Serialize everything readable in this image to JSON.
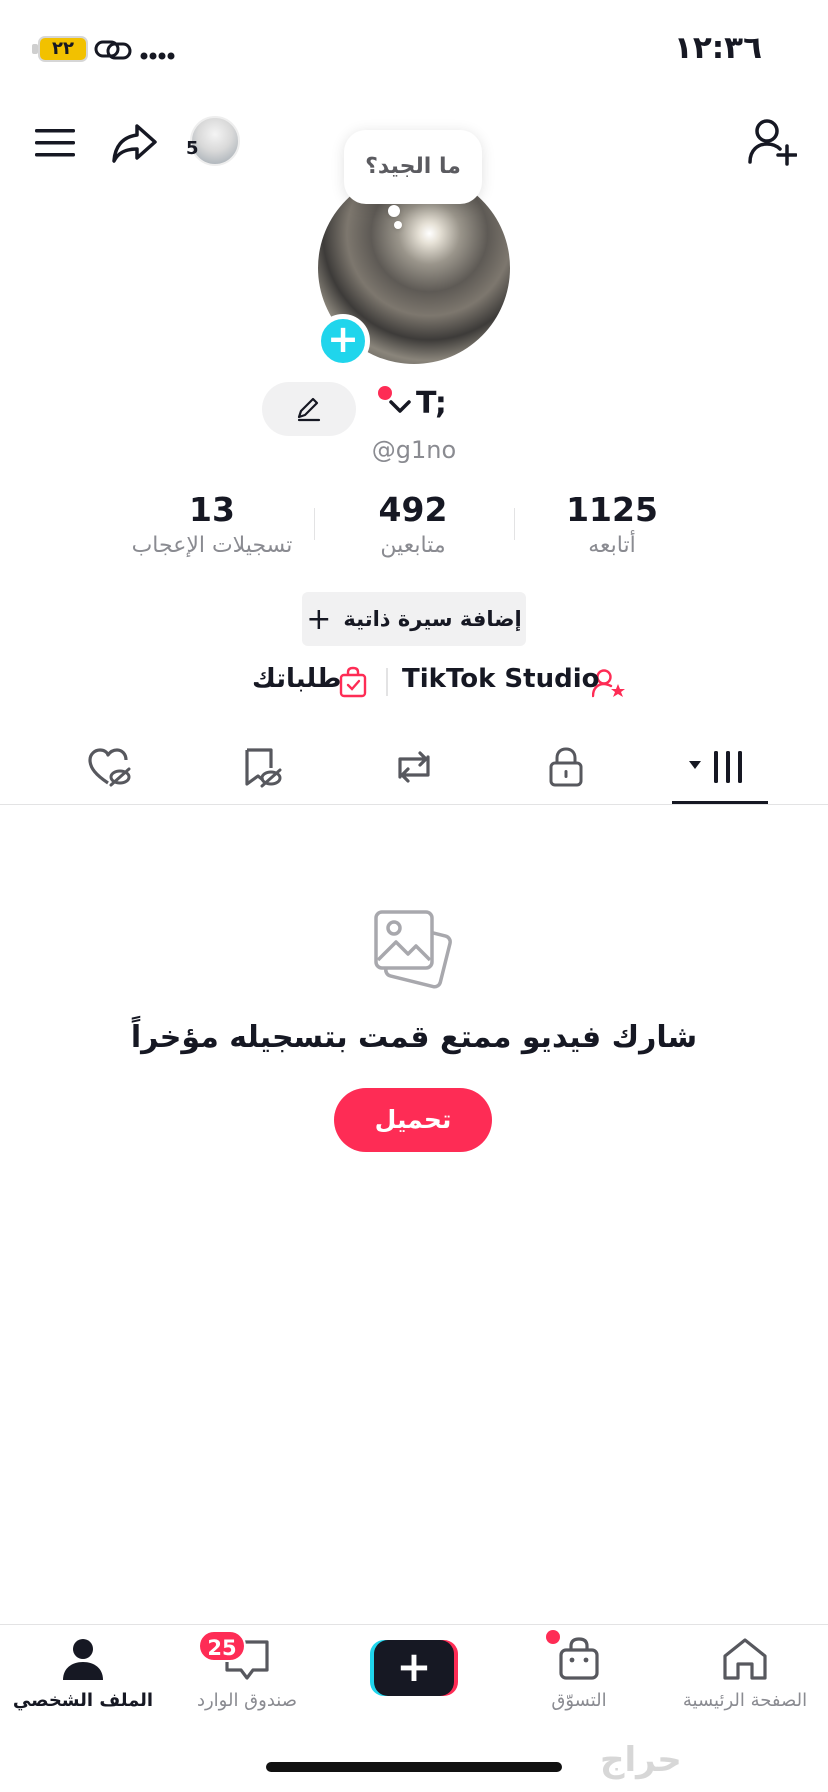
{
  "status_bar": {
    "time": "١٢:٣٦",
    "battery": "٢٢"
  },
  "profile": {
    "bubble_text": "ما الجيد؟",
    "name": "T;",
    "handle": "@g1no",
    "bio_button": "إضافة سيرة ذاتية",
    "story_count": "5"
  },
  "stats": [
    {
      "value": "1125",
      "label": "أتابعه"
    },
    {
      "value": "492",
      "label": "متابعين"
    },
    {
      "value": "13",
      "label": "تسجيلات الإعجاب"
    }
  ],
  "links": {
    "studio": "TikTok Studio",
    "orders": "طلباتك"
  },
  "empty_state": {
    "title": "شارك فيديو ممتع قمت بتسجيله مؤخراً",
    "button": "تحميل"
  },
  "bottom_nav": {
    "home": "الصفحة الرئيسية",
    "shop": "التسوّق",
    "inbox": "صندوق الوارد",
    "inbox_badge": "25",
    "profile": "الملف الشخصي"
  },
  "watermark": "حراج",
  "colors": {
    "accent": "#fe2c55",
    "cyan": "#20d5ec",
    "text": "#161823",
    "muted": "#8a8b91"
  }
}
